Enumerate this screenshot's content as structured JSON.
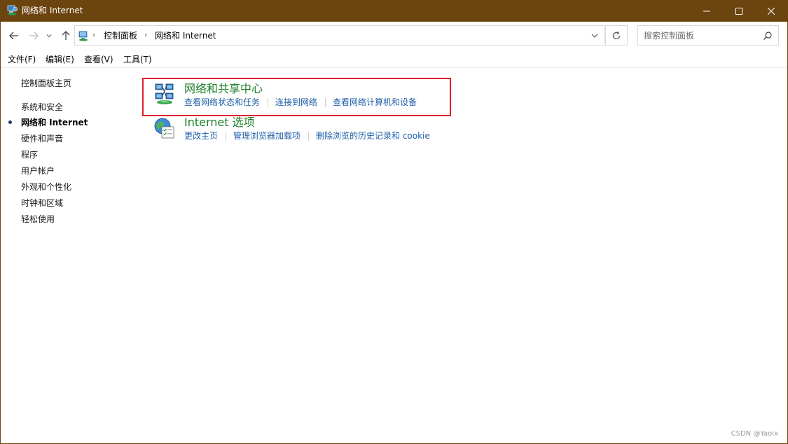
{
  "window": {
    "title": "网络和 Internet",
    "icon": "network-internet-icon",
    "controls": [
      "minimize-icon",
      "maximize-icon",
      "close-icon"
    ],
    "titlebar_color": "#6b4410"
  },
  "navigation": {
    "back": "back-arrow-icon",
    "forward": "forward-arrow-icon",
    "recent": "chevron-down-icon",
    "up": "up-arrow-icon",
    "breadcrumb": [
      "控制面板",
      "网络和 Internet"
    ],
    "refresh": "refresh-icon"
  },
  "search": {
    "placeholder": "搜索控制面板",
    "icon": "search-icon"
  },
  "menu": [
    "文件(F)",
    "编辑(E)",
    "查看(V)",
    "工具(T)"
  ],
  "sidebar": {
    "home": "控制面板主页",
    "items": [
      {
        "label": "系统和安全",
        "active": false
      },
      {
        "label": "网络和 Internet",
        "active": true
      },
      {
        "label": "硬件和声音",
        "active": false
      },
      {
        "label": "程序",
        "active": false
      },
      {
        "label": "用户帐户",
        "active": false
      },
      {
        "label": "外观和个性化",
        "active": false
      },
      {
        "label": "时钟和区域",
        "active": false
      },
      {
        "label": "轻松使用",
        "active": false
      }
    ]
  },
  "categories": [
    {
      "title": "网络和共享中心",
      "icon": "network-sharing-center-icon",
      "highlighted": true,
      "links": [
        "查看网络状态和任务",
        "连接到网络",
        "查看网络计算机和设备"
      ]
    },
    {
      "title": "Internet 选项",
      "icon": "internet-options-icon",
      "highlighted": false,
      "links": [
        "更改主页",
        "管理浏览器加载项",
        "删除浏览的历史记录和 cookie"
      ]
    }
  ],
  "colors": {
    "category_title": "#1e7f29",
    "link": "#1f5fa8",
    "highlight_border": "#e0202a"
  },
  "watermark": "CSDN @Yaoix"
}
